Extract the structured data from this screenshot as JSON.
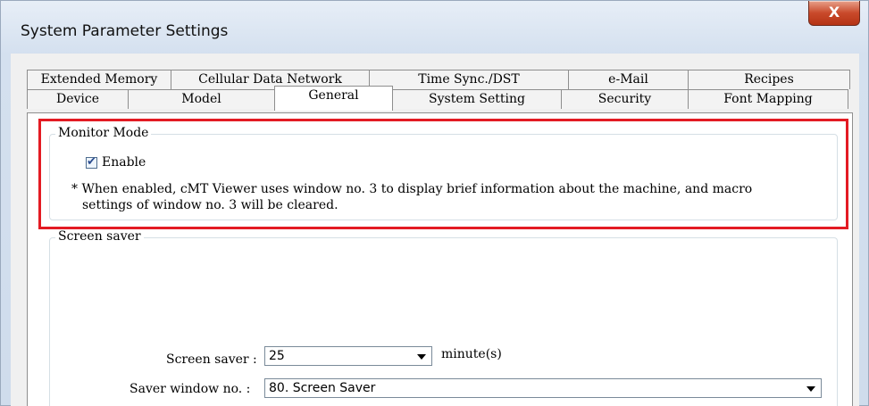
{
  "window": {
    "title": "System Parameter Settings",
    "close_glyph": "X"
  },
  "tabs_row1": [
    "Extended Memory",
    "Cellular Data Network",
    "Time Sync./DST",
    "e-Mail",
    "Recipes"
  ],
  "tabs_row2": [
    "Device",
    "Model",
    "General",
    "System Setting",
    "Security",
    "Font Mapping"
  ],
  "active_tab": "General",
  "monitor_mode": {
    "legend": "Monitor Mode",
    "enable_label": "Enable",
    "enable_checked": true,
    "note_line1": "* When enabled, cMT Viewer uses window no. 3 to display brief information about the machine, and macro",
    "note_line2": "settings of window no. 3 will be cleared."
  },
  "screen_saver": {
    "legend": "Screen saver",
    "saver_label": "Screen saver :",
    "saver_value": "25",
    "saver_unit": "minute(s)",
    "window_label": "Saver window no. :",
    "window_value": "80. Screen Saver"
  },
  "colors": {
    "highlight": "#e31b23",
    "close_button": "#c94a2b"
  }
}
